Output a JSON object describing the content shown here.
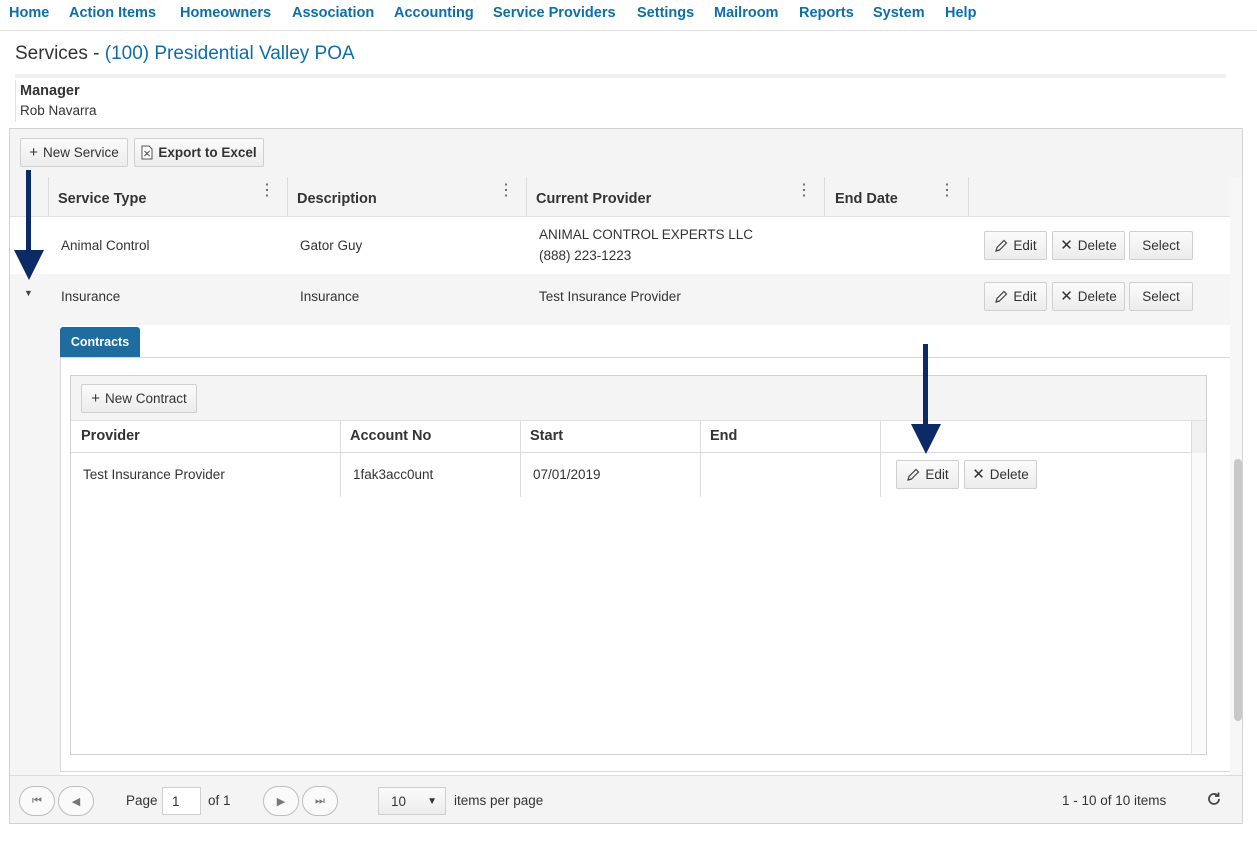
{
  "nav": {
    "items": [
      "Home",
      "Action Items",
      "Homeowners",
      "Association",
      "Accounting",
      "Service Providers",
      "Settings",
      "Mailroom",
      "Reports",
      "System",
      "Help"
    ]
  },
  "page": {
    "title_prefix": "Services - ",
    "association": "(100) Presidential Valley POA",
    "manager_label": "Manager",
    "manager_name": "Rob Navarra"
  },
  "toolbar": {
    "new_service": "New Service",
    "export_excel": "Export to Excel"
  },
  "columns": [
    "Service Type",
    "Description",
    "Current Provider",
    "End Date"
  ],
  "rows": [
    {
      "service_type": "Animal Control",
      "description": "Gator Guy",
      "provider_name": "ANIMAL CONTROL EXPERTS LLC",
      "provider_phone": "(888) 223-1223",
      "end_date": "",
      "actions": [
        "Edit",
        "Delete",
        "Select"
      ]
    },
    {
      "service_type": "Insurance",
      "description": "Insurance",
      "provider_name": "Test Insurance Provider",
      "provider_phone": "",
      "end_date": "",
      "actions": [
        "Edit",
        "Delete",
        "Select"
      ],
      "expanded": true
    }
  ],
  "detail": {
    "tab": "Contracts",
    "new_contract": "New Contract",
    "columns": [
      "Provider",
      "Account No",
      "Start",
      "End"
    ],
    "rows": [
      {
        "provider": "Test Insurance Provider",
        "account_no": "1fak3acc0unt",
        "start": "07/01/2019",
        "end": "",
        "actions": [
          "Edit",
          "Delete"
        ]
      }
    ]
  },
  "pager": {
    "page_label": "Page",
    "page_value": "1",
    "of_label": "of 1",
    "page_size": "10",
    "items_per_page": "items per page",
    "summary": "1 - 10 of 10 items"
  },
  "colors": {
    "nav_link": "#0e6ea9",
    "tab_active": "#1f6d9f",
    "annotation_arrow": "#0b2a66"
  }
}
